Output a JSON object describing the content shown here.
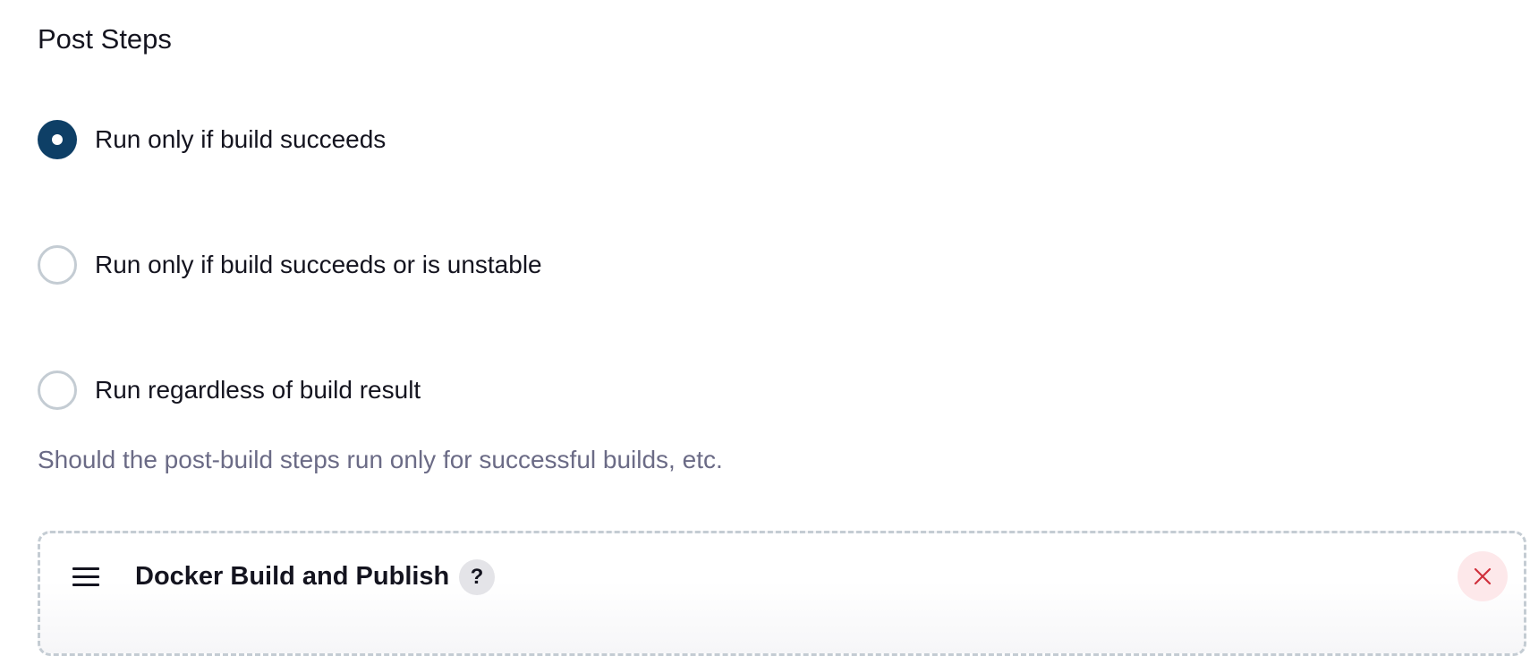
{
  "section": {
    "title": "Post Steps"
  },
  "options": [
    {
      "label": "Run only if build succeeds",
      "checked": true
    },
    {
      "label": "Run only if build succeeds or is unstable",
      "checked": false
    },
    {
      "label": "Run regardless of build result",
      "checked": false
    }
  ],
  "help_text": "Should the post-build steps run only for successful builds, etc.",
  "step": {
    "title": "Docker Build and Publish",
    "help_label": "?",
    "handle_icon": "hamburger-drag-icon",
    "close_icon": "close-x-icon"
  },
  "colors": {
    "radio_checked": "#0e3f66",
    "radio_unchecked_border": "#c4ccd3",
    "help_text": "#6b6b86",
    "close_icon": "#d0303c",
    "close_bg": "#fde8ea"
  }
}
